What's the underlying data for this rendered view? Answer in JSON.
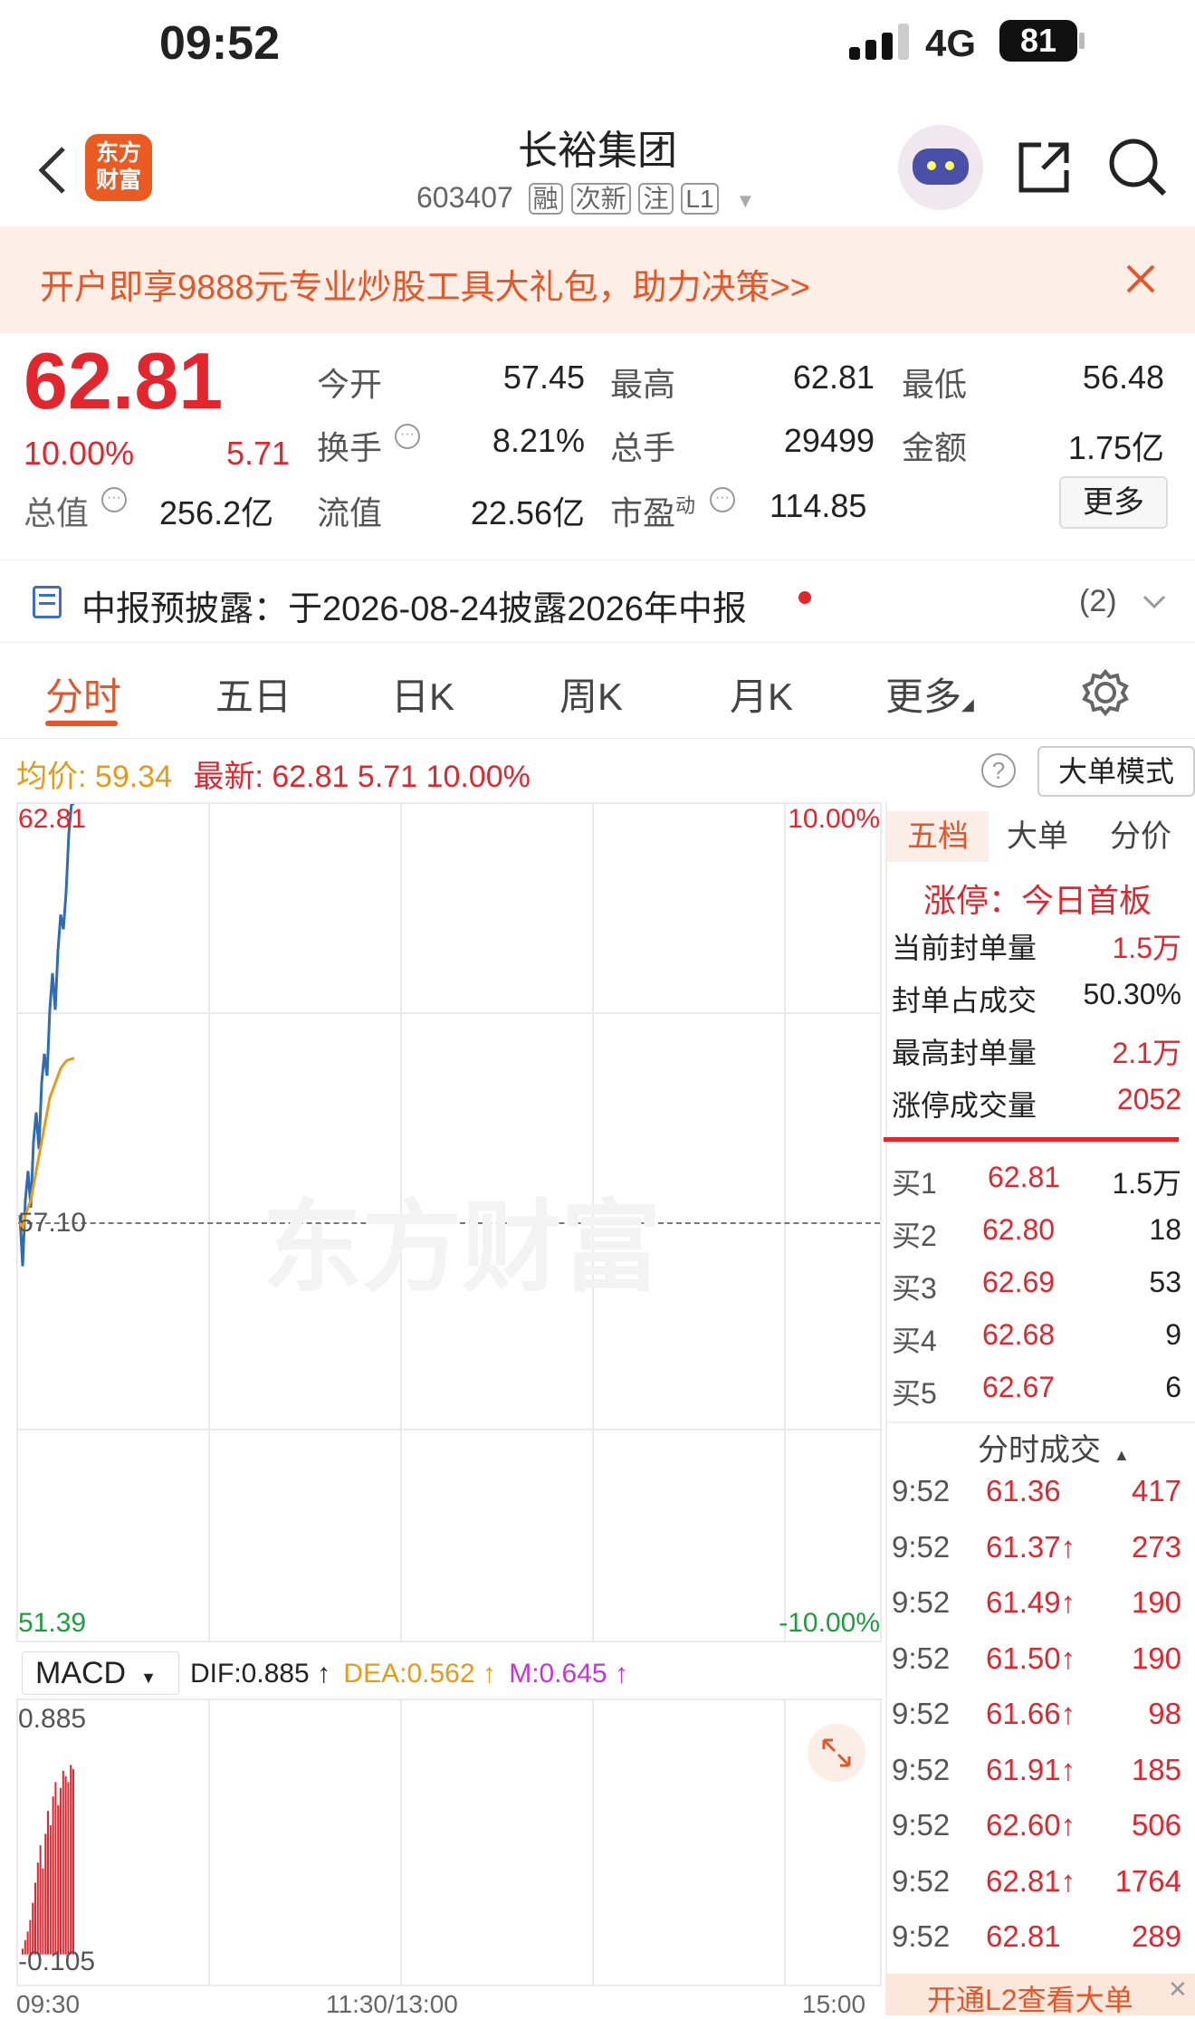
{
  "status": {
    "time": "09:52",
    "network": "4G",
    "battery": "81"
  },
  "header": {
    "title": "长裕集团",
    "code": "603407",
    "tags": [
      "融",
      "次新",
      "注",
      "L1"
    ],
    "logo_text": "东方财富"
  },
  "banner": {
    "text": "开户即享9888元专业炒股工具大礼包，助力决策>>"
  },
  "quote": {
    "price": "62.81",
    "change_pct": "10.00%",
    "change": "5.71",
    "open_label": "今开",
    "open": "57.45",
    "high_label": "最高",
    "high": "62.81",
    "low_label": "最低",
    "low": "56.48",
    "turnover_label": "换手",
    "turnover": "8.21%",
    "volume_label": "总手",
    "volume": "29499",
    "amount_label": "金额",
    "amount": "1.75亿",
    "mktcap_label": "总值",
    "mktcap": "256.2亿",
    "float_label": "流值",
    "float": "22.56亿",
    "pe_label": "市盈",
    "pe_sup": "动",
    "pe": "114.85",
    "more": "更多"
  },
  "disclosure": {
    "text": "中报预披露：于2026-08-24披露2026年中报",
    "count": "(2)"
  },
  "tabs": [
    "分时",
    "五日",
    "日K",
    "周K",
    "月K",
    "更多"
  ],
  "infobar": {
    "avg_label": "均价:",
    "avg": "59.34",
    "latest_label": "最新:",
    "latest": "62.81",
    "chg": "5.71",
    "pct": "10.00%",
    "mode": "大单模式"
  },
  "chart_data": {
    "type": "line",
    "title": "",
    "y_top": "62.81",
    "y_mid": "57.10",
    "y_bottom": "51.39",
    "pct_top": "10.00%",
    "pct_bottom": "-10.00%",
    "ylim": [
      51.39,
      62.81
    ],
    "series": [
      {
        "name": "",
        "values": [
          57.2,
          56.5,
          57.4,
          57.8,
          57.3,
          58.2,
          58.6,
          58.1,
          59.0,
          59.4,
          59.1,
          60.0,
          60.5,
          60.0,
          60.8,
          61.3,
          61.1,
          61.6,
          62.4,
          62.81,
          62.81
        ]
      },
      {
        "name": "",
        "values": [
          57.1,
          57.0,
          57.2,
          57.3,
          57.4,
          57.6,
          57.8,
          58.0,
          58.2,
          58.4,
          58.6,
          58.8,
          58.9,
          59.0,
          59.1,
          59.2,
          59.25,
          59.3,
          59.32,
          59.33,
          59.34
        ]
      }
    ],
    "x_ticks": [
      "09:30",
      "11:30/13:00",
      "15:00"
    ],
    "macd": {
      "label": "MACD",
      "dif_label": "DIF:",
      "dif": "0.885",
      "dea_label": "DEA:",
      "dea": "0.562",
      "m_label": "M:",
      "m": "0.645",
      "top": "0.885",
      "bottom": "-0.105",
      "bars": [
        0.02,
        0.05,
        0.08,
        0.12,
        0.18,
        0.25,
        0.32,
        0.38,
        0.3,
        0.42,
        0.5,
        0.45,
        0.55,
        0.6,
        0.52,
        0.58,
        0.64,
        0.62,
        0.6,
        0.66,
        0.645
      ]
    }
  },
  "orderbook": {
    "tabs": [
      "五档",
      "大单",
      "分价"
    ],
    "limit_up": "涨停：今日首板",
    "stats": [
      {
        "label": "当前封单量",
        "value": "1.5万"
      },
      {
        "label": "封单占成交",
        "value": "50.30%"
      },
      {
        "label": "最高封单量",
        "value": "2.1万"
      },
      {
        "label": "涨停成交量",
        "value": "2052"
      }
    ],
    "bids": [
      {
        "label": "买1",
        "price": "62.81",
        "vol": "1.5万"
      },
      {
        "label": "买2",
        "price": "62.80",
        "vol": "18"
      },
      {
        "label": "买3",
        "price": "62.69",
        "vol": "53"
      },
      {
        "label": "买4",
        "price": "62.68",
        "vol": "9"
      },
      {
        "label": "买5",
        "price": "62.67",
        "vol": "6"
      }
    ],
    "trades_title": "分时成交",
    "trades": [
      {
        "t": "9:52",
        "p": "61.36",
        "v": "417"
      },
      {
        "t": "9:52",
        "p": "61.37↑",
        "v": "273"
      },
      {
        "t": "9:52",
        "p": "61.49↑",
        "v": "190"
      },
      {
        "t": "9:52",
        "p": "61.50↑",
        "v": "190"
      },
      {
        "t": "9:52",
        "p": "61.66↑",
        "v": "98"
      },
      {
        "t": "9:52",
        "p": "61.91↑",
        "v": "185"
      },
      {
        "t": "9:52",
        "p": "62.60↑",
        "v": "506"
      },
      {
        "t": "9:52",
        "p": "62.81↑",
        "v": "1764"
      },
      {
        "t": "9:52",
        "p": "62.81",
        "v": "289"
      }
    ],
    "l2": "开通L2查看大单"
  },
  "watermark": "东方财富"
}
